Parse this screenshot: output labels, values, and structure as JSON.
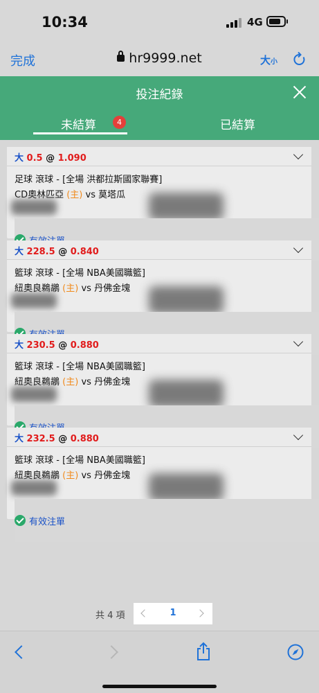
{
  "status_bar": {
    "time": "10:34",
    "network": "4G"
  },
  "browser": {
    "done_label": "完成",
    "url": "hr9999.net",
    "text_size_label": "大",
    "text_size_small": "小"
  },
  "header": {
    "title": "投注紀錄",
    "tabs": {
      "unsettled": "未結算",
      "unsettled_count": "4",
      "settled": "已結算"
    }
  },
  "bets": [
    {
      "side": "大",
      "line": "0.5",
      "at": "@",
      "odds": "1.090",
      "league": "足球 滾球 - [全場 洪都拉斯國家聯賽]",
      "team1": "CD奧林匹亞",
      "home_tag": "(主)",
      "vs": "vs",
      "team2": "莫塔瓜",
      "status": "有效注單"
    },
    {
      "side": "大",
      "line": "228.5",
      "at": "@",
      "odds": "0.840",
      "league": "籃球 滾球 - [全場 NBA美國職籃]",
      "team1": "紐奧良鵜鶘",
      "home_tag": "(主)",
      "vs": "vs",
      "team2": "丹佛金塊",
      "status": "有效注單"
    },
    {
      "side": "大",
      "line": "230.5",
      "at": "@",
      "odds": "0.880",
      "league": "籃球 滾球 - [全場 NBA美國職籃]",
      "team1": "紐奧良鵜鶘",
      "home_tag": "(主)",
      "vs": "vs",
      "team2": "丹佛金塊",
      "status": "有效注單"
    },
    {
      "side": "大",
      "line": "232.5",
      "at": "@",
      "odds": "0.880",
      "league": "籃球 滾球 - [全場 NBA美國職籃]",
      "team1": "紐奧良鵜鶘",
      "home_tag": "(主)",
      "vs": "vs",
      "team2": "丹佛金塊",
      "status": "有效注單"
    }
  ],
  "pagination": {
    "total": "共 4 項",
    "current_page": "1"
  },
  "colors": {
    "brand_green": "#46a97a",
    "link_blue": "#1f72d8",
    "odds_red": "#e11c1c",
    "home_orange": "#f08a1c",
    "badge_red": "#e4403a"
  },
  "icons": [
    "signal-icon",
    "battery-icon",
    "lock-icon",
    "reload-icon",
    "close-icon",
    "chevron-down-icon",
    "check-circle-icon",
    "back-icon",
    "forward-icon",
    "share-icon",
    "compass-icon"
  ]
}
